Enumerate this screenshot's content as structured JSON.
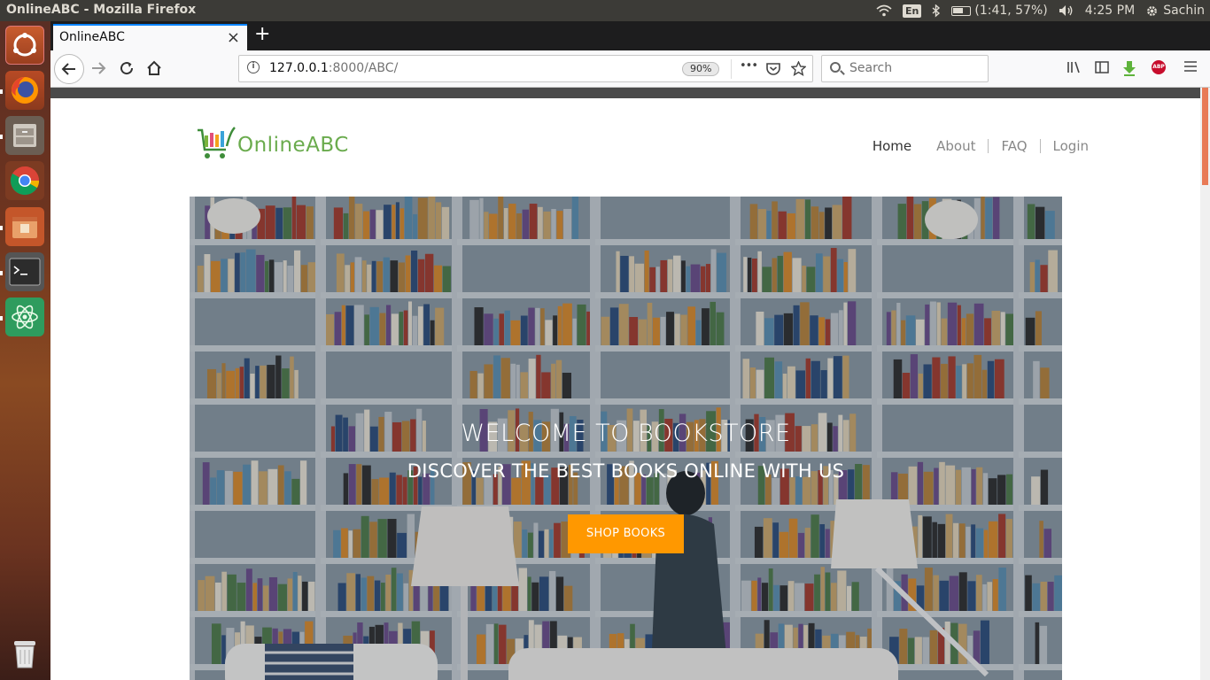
{
  "os": {
    "window_title": "OnlineABC - Mozilla Firefox",
    "keyboard": "En",
    "battery": "(1:41, 57%)",
    "time": "4:25 PM",
    "user": "Sachin"
  },
  "browser": {
    "tab_title": "OnlineABC",
    "tab_close": "×",
    "new_tab": "+",
    "url_host": "127.0.0.1",
    "url_path": ":8000/ABC/",
    "zoom": "90%",
    "search_placeholder": "Search",
    "page_actions": "•••"
  },
  "site": {
    "logo_text": "OnlineABC",
    "nav": [
      "Home",
      "About",
      "FAQ",
      "Login"
    ],
    "hero_title": "WELCOME TO BOOKSTORE",
    "hero_subtitle": "DISCOVER THE BEST BOOKS ONLINE WITH US",
    "cta": "SHOP BOOKS"
  },
  "colors": {
    "accent": "#ff9800",
    "logo": "#6aab4d",
    "tab_highlight": "#0a84ff"
  }
}
